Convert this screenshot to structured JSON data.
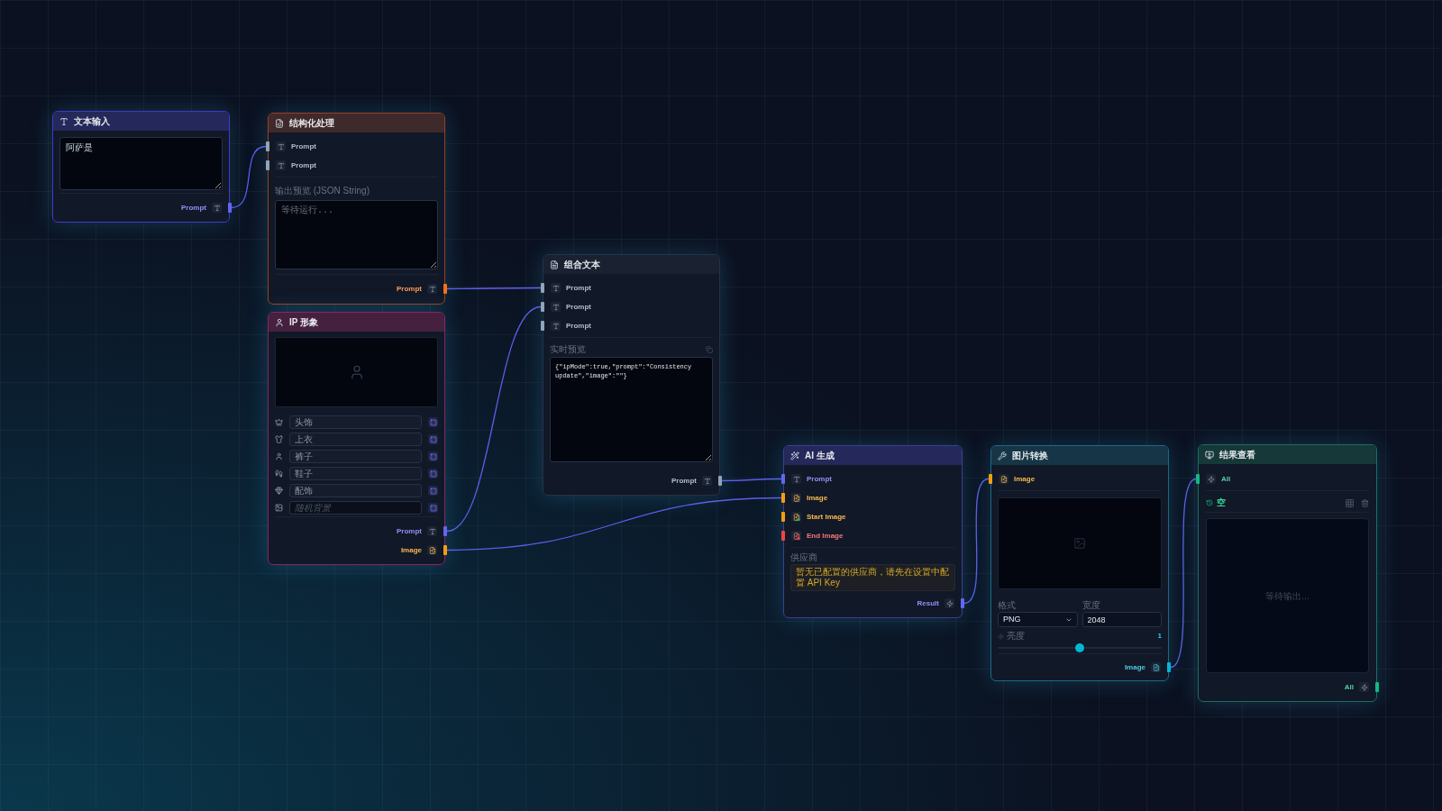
{
  "canvas": {
    "nodes": [
      {
        "kind": "text-input",
        "title": "文本输入",
        "text": {
          "value": "阿萨是"
        },
        "outputs": [
          {
            "label": "Prompt",
            "kind": "text",
            "color": "#6366f1"
          }
        ]
      },
      {
        "kind": "structured",
        "title": "结构化处理",
        "inputs": [
          {
            "label": "Prompt",
            "kind": "text",
            "color": "#94a3b8"
          },
          {
            "label": "Prompt",
            "kind": "text",
            "color": "#94a3b8"
          }
        ],
        "preview": {
          "label": "输出预览 (JSON String)",
          "placeholder": "等待运行..."
        },
        "outputs": [
          {
            "label": "Prompt",
            "kind": "text",
            "color": "#f97316"
          }
        ]
      },
      {
        "kind": "ip",
        "title": "IP 形象",
        "slots": [
          {
            "kind": "slot",
            "placeholder": "头饰"
          },
          {
            "kind": "slot",
            "placeholder": "上衣"
          },
          {
            "kind": "slot",
            "placeholder": "裤子"
          },
          {
            "kind": "slot",
            "placeholder": "鞋子"
          },
          {
            "kind": "slot",
            "placeholder": "配饰"
          },
          {
            "kind": "background",
            "placeholder": "随机背景"
          }
        ],
        "outputs": [
          {
            "label": "Prompt",
            "kind": "text",
            "color": "#6366f1"
          },
          {
            "label": "Image",
            "kind": "image",
            "color": "#f59e0b"
          }
        ]
      },
      {
        "kind": "combine",
        "title": "组合文本",
        "inputs": [
          {
            "label": "Prompt",
            "kind": "text",
            "color": "#94a3b8"
          },
          {
            "label": "Prompt",
            "kind": "text",
            "color": "#94a3b8"
          },
          {
            "label": "Prompt",
            "kind": "text",
            "color": "#94a3b8"
          }
        ],
        "preview": {
          "label": "实时预览",
          "value": "{\"ipMode\":true,\"prompt\":\"Consistency update\",\"image\":\"\"}"
        },
        "outputs": [
          {
            "label": "Prompt",
            "kind": "text",
            "color": "#94a3b8"
          }
        ]
      },
      {
        "kind": "ai",
        "title": "AI 生成",
        "inputs": [
          {
            "label": "Prompt",
            "kind": "text",
            "color": "#6366f1"
          },
          {
            "label": "Image",
            "kind": "image",
            "color": "#f59e0b"
          },
          {
            "label": "Start Image",
            "kind": "image-start",
            "color": "#f59e0b"
          },
          {
            "label": "End Image",
            "kind": "image-end",
            "color": "#ef4444"
          }
        ],
        "provider": {
          "label": "供应商",
          "warning": "暂无已配置的供应商，请先在设置中配置 API Key"
        },
        "outputs": [
          {
            "label": "Result",
            "kind": "any",
            "color": "#6366f1"
          }
        ]
      },
      {
        "kind": "convert",
        "title": "图片转换",
        "inputs": [
          {
            "label": "Image",
            "kind": "image",
            "color": "#f59e0b"
          }
        ],
        "format": {
          "label": "格式",
          "value": "PNG"
        },
        "width": {
          "label": "宽度",
          "value": "2048"
        },
        "brightness": {
          "label": "亮度",
          "reading": "1",
          "level": 0.5
        },
        "outputs": [
          {
            "label": "Image",
            "kind": "image",
            "color": "#06b6d4"
          }
        ]
      },
      {
        "kind": "viewer",
        "title": "结果查看",
        "inputs": [
          {
            "label": "All",
            "kind": "any",
            "color": "#10b981"
          }
        ],
        "history": {
          "label": "空"
        },
        "output_area": {
          "empty_text": "等待输出..."
        },
        "outputs": [
          {
            "label": "All",
            "kind": "any",
            "color": "#10b981"
          }
        ]
      }
    ]
  }
}
